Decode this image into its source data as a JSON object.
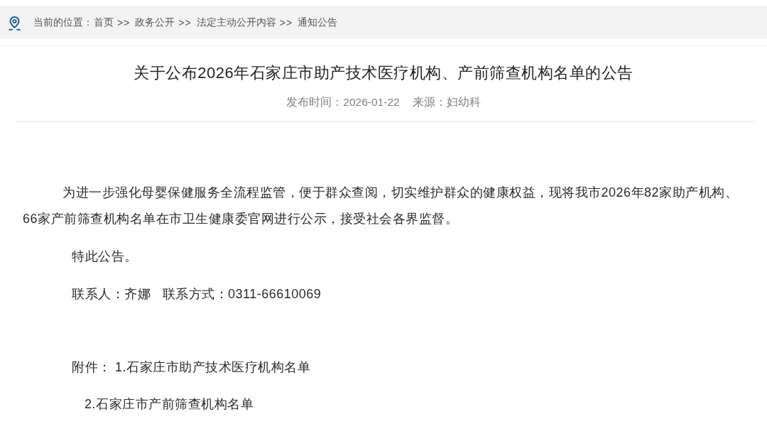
{
  "breadcrumb": {
    "label": "当前的位置：",
    "items": [
      {
        "label": "首页",
        "separator": ">>"
      },
      {
        "label": "政务公开",
        "separator": ">>"
      },
      {
        "label": "法定主动公开内容",
        "separator": ">>"
      },
      {
        "label": "通知公告"
      }
    ]
  },
  "article": {
    "title": "关于公布2026年石家庄市助产技术医疗机构、产前筛查机构名单的公告",
    "published": "发布时间：2026-01-22",
    "source": "来源：妇幼科",
    "paragraphs": [
      {
        "kind": "lead",
        "text": "为进一步强化母婴保健服务全流程监管，便于群众查阅，切实维护群众的健康权益，现将我市2026年82家助产机构、66家产前筛查机构名单在市卫生健康委官网进行公示，接受社会各界监督。"
      },
      {
        "kind": "note",
        "text": "特此公告。"
      },
      {
        "kind": "note",
        "text": "联系人：齐娜   联系方式：0311-66610069"
      }
    ],
    "attachments": {
      "label": "附件：",
      "items": [
        "1.石家庄市助产技术医疗机构名单",
        "2.石家庄市产前筛查机构名单"
      ]
    }
  }
}
